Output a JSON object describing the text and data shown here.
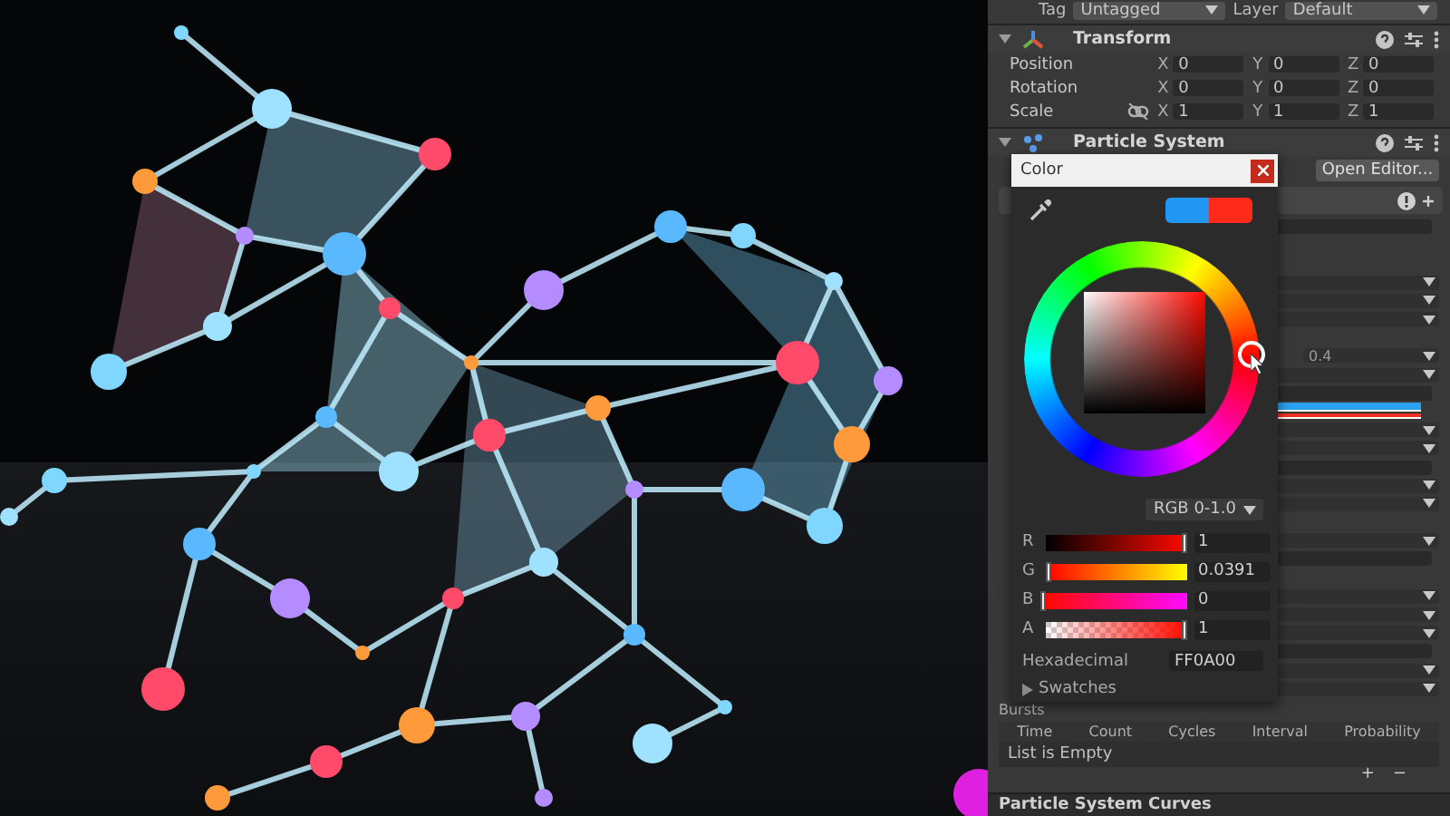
{
  "scene_view": {
    "kind": "render"
  },
  "inspector": {
    "tag": {
      "label": "Tag",
      "value": "Untagged"
    },
    "layer": {
      "label": "Layer",
      "value": "Default"
    },
    "transform": {
      "title": "Transform",
      "rows": [
        {
          "label": "Position",
          "axes": [
            "X",
            "Y",
            "Z"
          ],
          "values": [
            "0",
            "0",
            "0"
          ],
          "linked": false
        },
        {
          "label": "Rotation",
          "axes": [
            "X",
            "Y",
            "Z"
          ],
          "values": [
            "0",
            "0",
            "0"
          ],
          "linked": false
        },
        {
          "label": "Scale",
          "axes": [
            "X",
            "Y",
            "Z"
          ],
          "values": [
            "1",
            "1",
            "1"
          ],
          "linked": true
        }
      ]
    },
    "particle_system": {
      "title": "Particle System",
      "open_editor": "Open Editor...",
      "rows": [
        {
          "kind": "field"
        },
        {
          "kind": "gap"
        },
        {
          "kind": "gap"
        },
        {
          "kind": "dropdown"
        },
        {
          "kind": "dropdown"
        },
        {
          "kind": "dropdown"
        },
        {
          "kind": "gap"
        },
        {
          "kind": "value",
          "value": "0.4"
        },
        {
          "kind": "dropdown"
        },
        {
          "kind": "field"
        },
        {
          "kind": "gradient"
        },
        {
          "kind": "dropdown"
        },
        {
          "kind": "dropdown"
        },
        {
          "kind": "field"
        },
        {
          "kind": "dropdown"
        },
        {
          "kind": "dropdown"
        },
        {
          "kind": "gap"
        },
        {
          "kind": "dropdown"
        },
        {
          "kind": "field"
        },
        {
          "kind": "gap"
        },
        {
          "kind": "dropdown"
        },
        {
          "kind": "dropdown"
        },
        {
          "kind": "dropdown"
        },
        {
          "kind": "field"
        },
        {
          "kind": "dropdown"
        },
        {
          "kind": "dropdown"
        }
      ],
      "bursts": {
        "title": "Bursts",
        "columns": [
          "Time",
          "Count",
          "Cycles",
          "Interval",
          "Probability"
        ],
        "empty": "List is Empty",
        "add": "+",
        "remove": "−"
      }
    },
    "curves_title": "Particle System Curves"
  },
  "color_picker": {
    "title": "Color",
    "mode": "RGB 0-1.0",
    "sliders": [
      {
        "label": "R",
        "level": 1,
        "value": "1"
      },
      {
        "label": "G",
        "level": 0.0391,
        "value": "0.0391"
      },
      {
        "label": "B",
        "level": 0,
        "value": "0"
      },
      {
        "label": "A",
        "level": 1,
        "value": "1"
      }
    ],
    "hex_label": "Hexadecimal",
    "hex": "FF0A00",
    "swatches": {
      "label": "Swatches",
      "expanded": false
    }
  }
}
